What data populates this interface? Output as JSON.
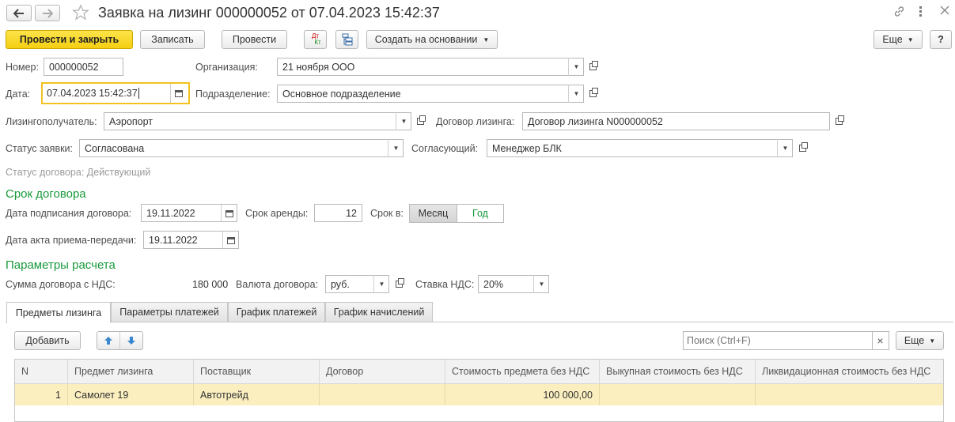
{
  "window": {
    "title": "Заявка на лизинг 000000052 от 07.04.2023 15:42:37"
  },
  "toolbar": {
    "post_close": "Провести и закрыть",
    "save": "Записать",
    "post": "Провести",
    "dtkt_top": "Дт",
    "dtkt_bottom": "Кт",
    "create_based": "Создать на основании",
    "more": "Еще",
    "help": "?"
  },
  "header": {
    "number_label": "Номер:",
    "number_value": "000000052",
    "org_label": "Организация:",
    "org_value": "21 ноября ООО",
    "date_label": "Дата:",
    "date_value": "07.04.2023 15:42:37",
    "division_label": "Подразделение:",
    "division_value": "Основное подразделение",
    "lessee_label": "Лизингополучатель:",
    "lessee_value": "Аэропорт",
    "contract_label": "Договор лизинга:",
    "contract_value": "Договор лизинга N000000052",
    "status_label": "Статус заявки:",
    "status_value": "Согласована",
    "approver_label": "Согласующий:",
    "approver_value": "Менеджер БЛК",
    "contract_status": "Статус договора: Действующий"
  },
  "term": {
    "section_title": "Срок договора",
    "sign_date_label": "Дата подписания договора:",
    "sign_date_value": "19.11.2022",
    "lease_term_label": "Срок аренды:",
    "lease_term_value": "12",
    "term_in_label": "Срок в:",
    "unit_month": "Месяц",
    "unit_year": "Год",
    "act_date_label": "Дата акта приема-передачи:",
    "act_date_value": "19.11.2022"
  },
  "calc": {
    "section_title": "Параметры расчета",
    "sum_label": "Сумма договора с НДС:",
    "sum_value": "180 000",
    "currency_label": "Валюта договора:",
    "currency_value": "руб.",
    "vat_label": "Ставка НДС:",
    "vat_value": "20%"
  },
  "tabs": [
    {
      "label": "Предметы лизинга"
    },
    {
      "label": "Параметры платежей"
    },
    {
      "label": "График платежей"
    },
    {
      "label": "График начислений"
    }
  ],
  "table_toolbar": {
    "add": "Добавить",
    "search_placeholder": "Поиск (Ctrl+F)",
    "clear": "×",
    "more": "Еще"
  },
  "table": {
    "columns": [
      "N",
      "Предмет лизинга",
      "Поставщик",
      "Договор",
      "Стоимость предмета без НДС",
      "Выкупная стоимость без НДС",
      "Ликвидационная стоимость без НДС"
    ],
    "rows": [
      {
        "n": "1",
        "item": "Самолет 19",
        "supplier": "Автотрейд",
        "contract": "",
        "cost": "100 000,00",
        "buyout": "",
        "liquidation": ""
      }
    ]
  }
}
